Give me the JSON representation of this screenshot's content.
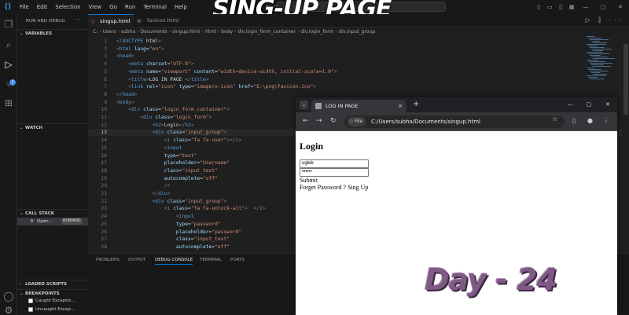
{
  "titlebar": {
    "menu": [
      "File",
      "Edit",
      "Selection",
      "View",
      "Go",
      "Run",
      "Terminal",
      "Help"
    ]
  },
  "overlay": {
    "title": "SING-UP PAGE",
    "day": "Day - 24"
  },
  "sidebar": {
    "title": "RUN AND DEBUG",
    "sections": {
      "variables": "VARIABLES",
      "watch": "WATCH",
      "callstack": "CALL STACK",
      "loaded_scripts": "LOADED SCRIPTS",
      "breakpoints": "BREAKPOINTS"
    },
    "callstack_item": {
      "name": "Open ...",
      "status": "RUNNING"
    },
    "breakpoints": [
      "Caught Exceptio...",
      "Uncaught Excep..."
    ]
  },
  "tabs": [
    {
      "label": "singup.html",
      "active": true
    },
    {
      "label": "favicon.html",
      "active": false
    }
  ],
  "breadcrumb": [
    "C:",
    "Users",
    "subha",
    "Documents",
    "singup.html",
    "html",
    "body",
    "div.login_form_container",
    "div.login_form",
    "div.input_group"
  ],
  "code": {
    "current_line": 13,
    "lines": [
      {
        "n": "1",
        "text": "<!DOCTYPE html>"
      },
      {
        "n": "2",
        "text": "<html lang=\"en\">"
      },
      {
        "n": "3",
        "text": "<head>"
      },
      {
        "n": "4",
        "text": "    <meta charset=\"UTF-8\">"
      },
      {
        "n": "5",
        "text": "    <meta name=\"viewport\" content=\"width=device-width, initial-scale=1.0\">"
      },
      {
        "n": "6",
        "text": "    <title>LOG IN PAGE </title>"
      },
      {
        "n": "7",
        "text": "    <link rel=\"icon\" type=\"image/x-icon\" href=\"E:\\png\\favicon.ico\">"
      },
      {
        "n": "8",
        "text": "</head>"
      },
      {
        "n": "9",
        "text": "<body>"
      },
      {
        "n": "10",
        "text": "    <div class=\"login_form_container\">"
      },
      {
        "n": "11",
        "text": "        <div class=\"login_form\">"
      },
      {
        "n": "12",
        "text": "            <h2>Login</h2>"
      },
      {
        "n": "13",
        "text": "            <div class=\"input_group\">"
      },
      {
        "n": "14",
        "text": "                <i class=\"fa fa-user\"></i>"
      },
      {
        "n": "15",
        "text": "                <input"
      },
      {
        "n": "16",
        "text": "                type=\"text\""
      },
      {
        "n": "17",
        "text": "                placeholder=\"Username\""
      },
      {
        "n": "18",
        "text": "                class=\"input_text\""
      },
      {
        "n": "19",
        "text": "                autocomplete=\"off\""
      },
      {
        "n": "20",
        "text": "                />"
      },
      {
        "n": "21",
        "text": "            </div>"
      },
      {
        "n": "22",
        "text": "            <div class=\"input_group\">"
      },
      {
        "n": "23",
        "text": "                <i class=\"fa fa-unlock-alt\">  </i>"
      },
      {
        "n": "24",
        "text": "                    <input"
      },
      {
        "n": "25",
        "text": "                    type=\"password\""
      },
      {
        "n": "26",
        "text": "                    placeholder=\"password\""
      },
      {
        "n": "27",
        "text": "                    class=\"input_text\""
      },
      {
        "n": "28",
        "text": "                    autocomplete=\"off\""
      }
    ]
  },
  "panel": {
    "tabs": [
      "PROBLEMS",
      "OUTPUT",
      "DEBUG CONSOLE",
      "TERMINAL",
      "PORTS"
    ],
    "active": "DEBUG CONSOLE"
  },
  "browser": {
    "tab_title": "LOG IN PAGE",
    "chip": "File",
    "url": "C:/Users/subha/Documents/singup.html",
    "page": {
      "heading": "Login",
      "username_value": "ugleb",
      "password_value": "••••••",
      "submit": "Submit",
      "footer": "Forget Password ? Sing Up"
    }
  }
}
